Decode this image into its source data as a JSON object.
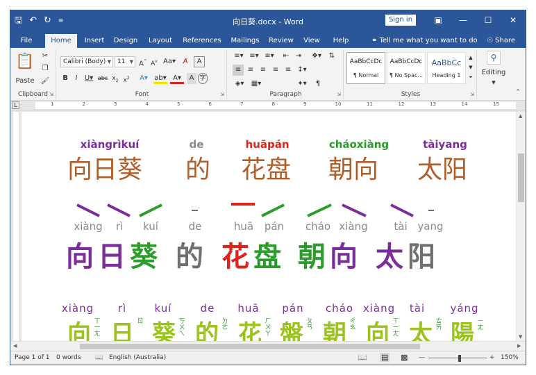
{
  "window": {
    "title": "向日葵.docx - Word",
    "signin_label": "Sign in"
  },
  "qat": {
    "save_icon": "save-icon",
    "undo_icon": "undo-icon",
    "redo_icon": "redo-icon"
  },
  "tabs": [
    {
      "label": "File"
    },
    {
      "label": "Home"
    },
    {
      "label": "Insert"
    },
    {
      "label": "Design"
    },
    {
      "label": "Layout"
    },
    {
      "label": "References"
    },
    {
      "label": "Mailings"
    },
    {
      "label": "Review"
    },
    {
      "label": "View"
    },
    {
      "label": "Help"
    }
  ],
  "tellme": "Tell me what you want to do",
  "share": "Share",
  "ribbon": {
    "clipboard": {
      "label": "Clipboard",
      "paste": "Paste"
    },
    "font": {
      "label": "Font",
      "name": "Calibri (Body)",
      "size": "11"
    },
    "paragraph": {
      "label": "Paragraph"
    },
    "styles": {
      "label": "Styles",
      "items": [
        {
          "preview": "AaBbCcDc",
          "name": "¶ Normal"
        },
        {
          "preview": "AaBbCcDc",
          "name": "¶ No Spac..."
        },
        {
          "preview": "AaBbCc",
          "name": "Heading 1"
        }
      ]
    },
    "editing": {
      "label": "Editing"
    }
  },
  "ruler": [
    "1",
    "2",
    "3",
    "4",
    "5",
    "6",
    "7",
    "8",
    "9",
    "10",
    "11",
    "12",
    "13",
    "14",
    "15"
  ],
  "doc": {
    "line1": {
      "pinyin": [
        {
          "text": "xiàngrìkuí",
          "color": "#7b2d9c"
        },
        {
          "text": "de",
          "color": "#8a8a8a"
        },
        {
          "text": "huāpán",
          "color": "#e0241c"
        },
        {
          "text": "cháoxiàng",
          "color": "#2a9d2a"
        },
        {
          "text": "tàiyang",
          "color": "#7b2d9c"
        }
      ],
      "hanzi": [
        "向日葵",
        "的",
        "花盘",
        "朝向",
        "太阳"
      ]
    },
    "line2": {
      "pinyin": [
        "xiàng",
        "rì",
        "kuí",
        "de",
        "huā",
        "pán",
        "cháo",
        "xiàng",
        "tài",
        "yang"
      ],
      "hanzi": [
        {
          "char": "向",
          "color": "#7b2d9c"
        },
        {
          "char": "日",
          "color": "#7b2d9c"
        },
        {
          "char": "葵",
          "color": "#2a9d2a"
        },
        {
          "char": "的",
          "color": "#707070"
        },
        {
          "char": "花",
          "color": "#e0241c"
        },
        {
          "char": "盘",
          "color": "#2a9d2a"
        },
        {
          "char": "朝",
          "color": "#2a9d2a"
        },
        {
          "char": "向",
          "color": "#7b2d9c"
        },
        {
          "char": "太",
          "color": "#7b2d9c"
        },
        {
          "char": "阳",
          "color": "#707070"
        }
      ]
    },
    "line3": {
      "pinyin": [
        "xiàng",
        "rì",
        "kuí",
        "de",
        "huā",
        "pán",
        "cháo",
        "xiàng",
        "tài",
        "yáng"
      ],
      "hanzi": [
        "向",
        "日",
        "葵",
        "的",
        "花",
        "盤",
        "朝",
        "向",
        "太",
        "陽"
      ],
      "zhuyin": [
        "ㄒ\nㄧ\nㄤ",
        "ㄖ",
        "ㄎ\nㄨ\nㄟ",
        "ㄉ\nㄜ",
        "ㄏ\nㄨ\nㄚ",
        "ㄆ\nㄢ",
        "ㄔ\nㄠ",
        "ㄒ\nㄧ\nㄤ",
        "ㄊ\nㄞ",
        "ㄧ\nㄤ"
      ]
    }
  },
  "status": {
    "page": "Page 1 of 1",
    "words": "0 words",
    "language": "English (Australia)",
    "zoom": "150%"
  }
}
